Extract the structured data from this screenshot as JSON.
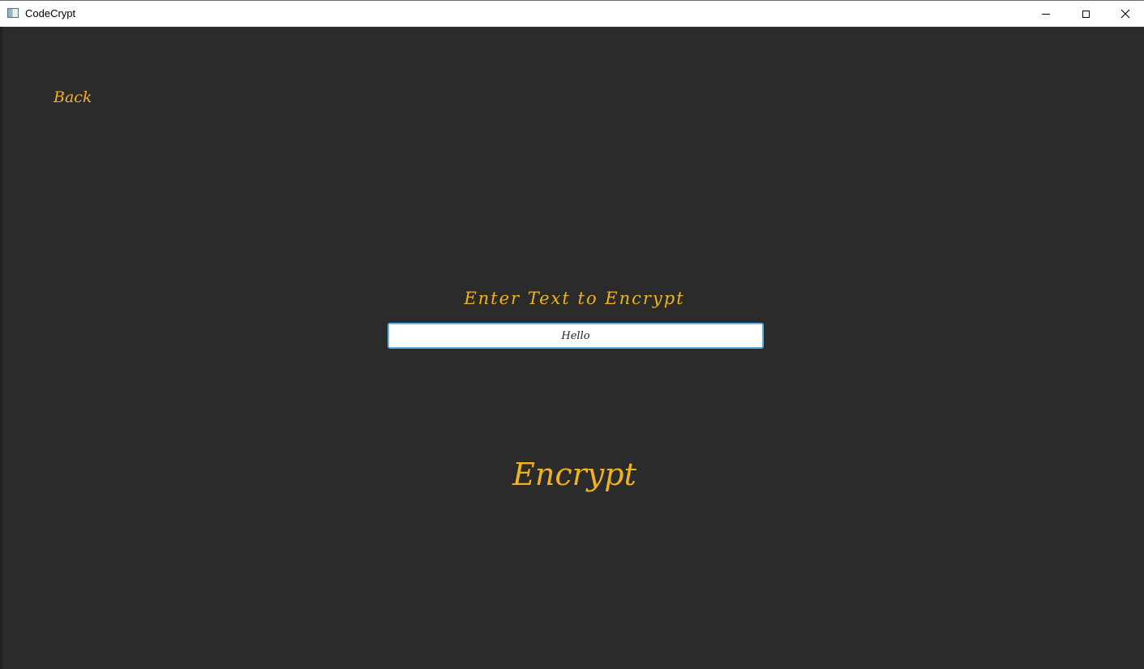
{
  "window": {
    "title": "CodeCrypt"
  },
  "icons": {
    "app": "app-window-icon",
    "minimize": "minimize-icon",
    "maximize": "maximize-icon",
    "close": "close-icon"
  },
  "colors": {
    "background": "#2b2b2b",
    "accent": "#f0b31c",
    "input_border": "#5ab4e6"
  },
  "nav": {
    "back_label": "Back"
  },
  "form": {
    "prompt": "Enter Text to Encrypt",
    "input_value": "Hello",
    "submit_label": "Encrypt"
  }
}
